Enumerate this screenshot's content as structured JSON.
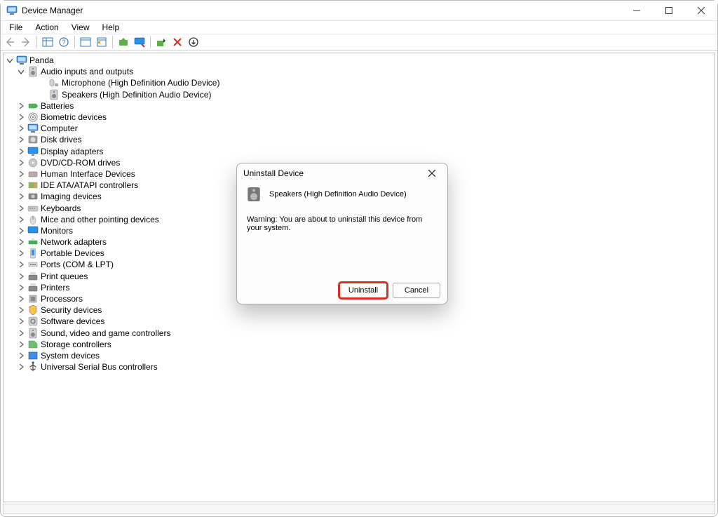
{
  "window": {
    "title": "Device Manager"
  },
  "menus": {
    "file": "File",
    "action": "Action",
    "view": "View",
    "help": "Help"
  },
  "tree": {
    "root": "Panda",
    "audio_category": "Audio inputs and outputs",
    "audio_children": {
      "microphone": "Microphone (High Definition Audio Device)",
      "speakers": "Speakers (High Definition Audio Device)"
    },
    "categories": {
      "batteries": "Batteries",
      "biometric": "Biometric devices",
      "computer": "Computer",
      "disk": "Disk drives",
      "display": "Display adapters",
      "dvd": "DVD/CD-ROM drives",
      "hid": "Human Interface Devices",
      "ide": "IDE ATA/ATAPI controllers",
      "imaging": "Imaging devices",
      "keyboards": "Keyboards",
      "mice": "Mice and other pointing devices",
      "monitors": "Monitors",
      "network": "Network adapters",
      "portable": "Portable Devices",
      "ports": "Ports (COM & LPT)",
      "printq": "Print queues",
      "printers": "Printers",
      "processors": "Processors",
      "security": "Security devices",
      "software": "Software devices",
      "sound": "Sound, video and game controllers",
      "storage": "Storage controllers",
      "system": "System devices",
      "usb": "Universal Serial Bus controllers"
    }
  },
  "dialog": {
    "title": "Uninstall Device",
    "device": "Speakers (High Definition Audio Device)",
    "warning": "Warning: You are about to uninstall this device from your system.",
    "uninstall": "Uninstall",
    "cancel": "Cancel"
  }
}
